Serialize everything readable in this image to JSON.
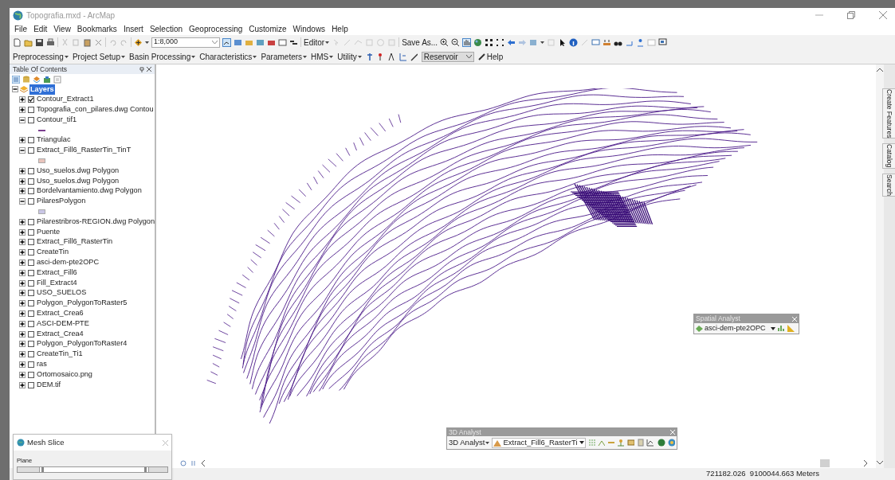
{
  "window": {
    "title": "Topografia.mxd - ArcMap"
  },
  "menu": [
    "File",
    "Edit",
    "View",
    "Bookmarks",
    "Insert",
    "Selection",
    "Geoprocessing",
    "Customize",
    "Windows",
    "Help"
  ],
  "standard_toolbar": {
    "scale": "1:8,000",
    "editor": "Editor",
    "save_as": "Save As..."
  },
  "hec_toolbar": {
    "menus": [
      "Preprocessing",
      "Project Setup",
      "Basin Processing",
      "Characteristics",
      "Parameters",
      "HMS",
      "Utility"
    ],
    "reservoir": "Reservoir",
    "help": "Help"
  },
  "toc": {
    "title": "Table Of Contents",
    "root": {
      "label": "Layers",
      "selected": true,
      "expanded": true
    },
    "layers": [
      {
        "name": "Contour_Extract1",
        "expanded": false,
        "checked": true
      },
      {
        "name": "Topografia_con_pilares.dwg Contou",
        "expanded": false,
        "checked": false
      },
      {
        "name": "Contour_tif1",
        "expanded": true,
        "checked": false,
        "legend": {
          "kind": "line",
          "color": "#7b3f8f"
        }
      },
      {
        "name": "Triangulac",
        "expanded": false,
        "checked": false
      },
      {
        "name": "Extract_Fill6_RasterTin_TinT",
        "expanded": true,
        "checked": false,
        "legend": {
          "kind": "fill",
          "color": "#e8c4bc"
        }
      },
      {
        "name": "Uso_suelos.dwg Polygon",
        "expanded": false,
        "checked": false
      },
      {
        "name": "Uso_suelos.dwg Polygon",
        "expanded": false,
        "checked": false
      },
      {
        "name": "Bordelvantamiento.dwg Polygon",
        "expanded": false,
        "checked": false
      },
      {
        "name": "PilaresPolygon",
        "expanded": true,
        "checked": false,
        "legend": {
          "kind": "fill",
          "color": "#c9c6e6"
        }
      },
      {
        "name": "Pilarestribros-REGION.dwg Polygon",
        "expanded": false,
        "checked": false
      },
      {
        "name": "Puente",
        "expanded": false,
        "checked": false
      },
      {
        "name": "Extract_Fill6_RasterTin",
        "expanded": false,
        "checked": false
      },
      {
        "name": "CreateTin",
        "expanded": false,
        "checked": false
      },
      {
        "name": "asci-dem-pte2OPC",
        "expanded": false,
        "checked": false
      },
      {
        "name": "Extract_Fill6",
        "expanded": false,
        "checked": false
      },
      {
        "name": "Fill_Extract4",
        "expanded": false,
        "checked": false
      },
      {
        "name": "USO_SUELOS",
        "expanded": false,
        "checked": false
      },
      {
        "name": "Polygon_PolygonToRaster5",
        "expanded": false,
        "checked": false
      },
      {
        "name": "Extract_Crea6",
        "expanded": false,
        "checked": false
      },
      {
        "name": "ASCI-DEM-PTE",
        "expanded": false,
        "checked": false
      },
      {
        "name": "Extract_Crea4",
        "expanded": false,
        "checked": false
      },
      {
        "name": "Polygon_PolygonToRaster4",
        "expanded": false,
        "checked": false
      },
      {
        "name": "CreateTin_Ti1",
        "expanded": false,
        "checked": false
      },
      {
        "name": "ras",
        "expanded": false,
        "checked": false
      },
      {
        "name": "Ortomosaico.png",
        "expanded": false,
        "checked": false
      },
      {
        "name": "DEM.tif",
        "expanded": false,
        "checked": false
      }
    ]
  },
  "dock_tabs": [
    "Create Features",
    "Catalog",
    "Search"
  ],
  "spatial_analyst": {
    "title": "Spatial Analyst",
    "layer": "asci-dem-pte2OPC"
  },
  "analyst_3d": {
    "title": "3D Analyst",
    "menu": "3D Analyst",
    "layer": "Extract_Fill6_RasterTi"
  },
  "mesh_slice": {
    "title": "Mesh Slice",
    "plane_label": "Plane"
  },
  "status_bar": {
    "coordinates": "721182.026  9100044.663 Meters"
  }
}
